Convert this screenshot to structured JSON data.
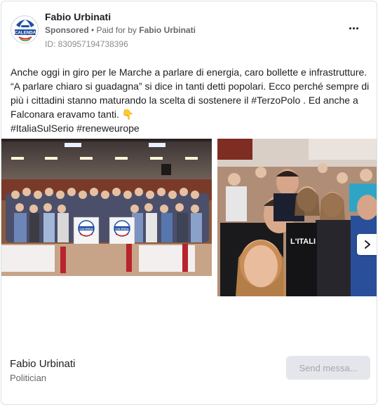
{
  "header": {
    "page_name": "Fabio Urbinati",
    "sponsored_label": "Sponsored",
    "separator": " • ",
    "paid_for_label": "Paid for by ",
    "paid_for_name": "Fabio Urbinati",
    "ad_id": "ID: 830957194738396",
    "avatar_text": "CALENDA",
    "avatar_icon": "party-logo-icon",
    "more_icon": "more-options-icon"
  },
  "post": {
    "lines": [
      "Anche oggi in giro per le Marche a parlare di energia, caro bollette e infrastrutture.",
      "“A parlare chiaro si guadagna” si dice in tanti detti popolari. Ecco perché sempre di",
      "più i cittadini stanno maturando la scelta di sostenere il #TerzoPolo . Ed anche a",
      "Falconara eravamo tanti. 👇",
      "#ItaliaSulSerio #reneweurope"
    ]
  },
  "carousel": {
    "images": [
      {
        "icon": "group-photo-meeting-hall-image",
        "sign_text": "CALENDA"
      },
      {
        "icon": "selfie-photo-image",
        "sign_text": "L'ITALI"
      }
    ],
    "next_icon": "chevron-right-icon"
  },
  "footer": {
    "name": "Fabio Urbinati",
    "category": "Politician",
    "send_button": "Send messa..."
  }
}
